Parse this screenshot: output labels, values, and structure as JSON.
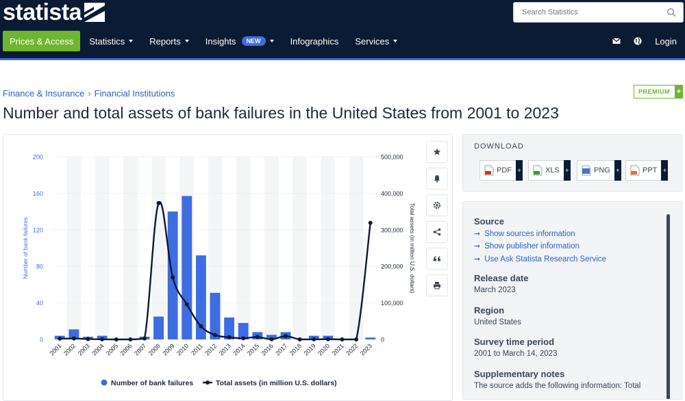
{
  "header": {
    "logo_text": "statista",
    "search_placeholder": "Search Statistics",
    "nav": {
      "prices": "Prices & Access",
      "statistics": "Statistics",
      "reports": "Reports",
      "insights": "Insights",
      "new_badge": "NEW",
      "infographics": "Infographics",
      "services": "Services",
      "login": "Login"
    },
    "colors": {
      "bg": "#0b1b33",
      "accent": "#6fb62e",
      "blue": "#3d6de0"
    }
  },
  "breadcrumb": {
    "item1": "Finance & Insurance",
    "item2": "Financial Institutions",
    "separator": "›"
  },
  "premium_label": "PREMIUM",
  "title": "Number and total assets of bank failures in the United States from 2001 to 2023",
  "download": {
    "label": "DOWNLOAD",
    "buttons": [
      {
        "label": "PDF",
        "color": "#d4312b"
      },
      {
        "label": "XLS",
        "color": "#3f9a37"
      },
      {
        "label": "PNG",
        "color": "#4a73c7"
      },
      {
        "label": "PPT",
        "color": "#e0742d"
      }
    ]
  },
  "info": {
    "source_h": "Source",
    "link1": "Show sources information",
    "link2": "Show publisher information",
    "link3": "Use Ask Statista Research Service",
    "release_h": "Release date",
    "release_v": "March 2023",
    "region_h": "Region",
    "region_v": "United States",
    "survey_h": "Survey time period",
    "survey_v": "2001 to March 14, 2023",
    "notes_h": "Supplementary notes",
    "notes_v": "The source adds the following information: Total"
  },
  "chart_data": {
    "type": "bar",
    "categories": [
      "2001",
      "2002",
      "2003",
      "2004",
      "2005",
      "2006",
      "2007",
      "2008",
      "2009",
      "2010",
      "2011",
      "2012",
      "2013",
      "2014",
      "2015",
      "2016",
      "2017",
      "2018",
      "2019",
      "2020",
      "2021",
      "2022",
      "2023"
    ],
    "series": [
      {
        "name": "Number of bank failures",
        "type": "bar",
        "axis": "left",
        "color": "#3d6de0",
        "values": [
          4,
          11,
          3,
          4,
          0,
          0,
          3,
          25,
          140,
          157,
          92,
          51,
          24,
          18,
          8,
          5,
          8,
          0,
          4,
          4,
          0,
          0,
          2
        ]
      },
      {
        "name": "Total assets (in million U.S. dollars)",
        "type": "line",
        "axis": "right",
        "color": "#0b1b33",
        "values": [
          2000,
          2500,
          1000,
          200,
          0,
          0,
          2600,
          373000,
          170000,
          96000,
          36000,
          12000,
          6000,
          3000,
          6700,
          300,
          9000,
          0,
          200,
          400,
          0,
          0,
          319000
        ]
      }
    ],
    "ylabel_left": "Number of bank failures",
    "ylabel_right": "Total assets (in million U.S. dollars)",
    "ylim_left": [
      0,
      200
    ],
    "ylim_right": [
      0,
      500000
    ],
    "yticks_left": [
      "0",
      "40",
      "80",
      "120",
      "160",
      "200"
    ],
    "yticks_right": [
      "0",
      "100,000",
      "200,000",
      "300,000",
      "400,000",
      "500,000"
    ],
    "legend_placement": "bottom"
  }
}
